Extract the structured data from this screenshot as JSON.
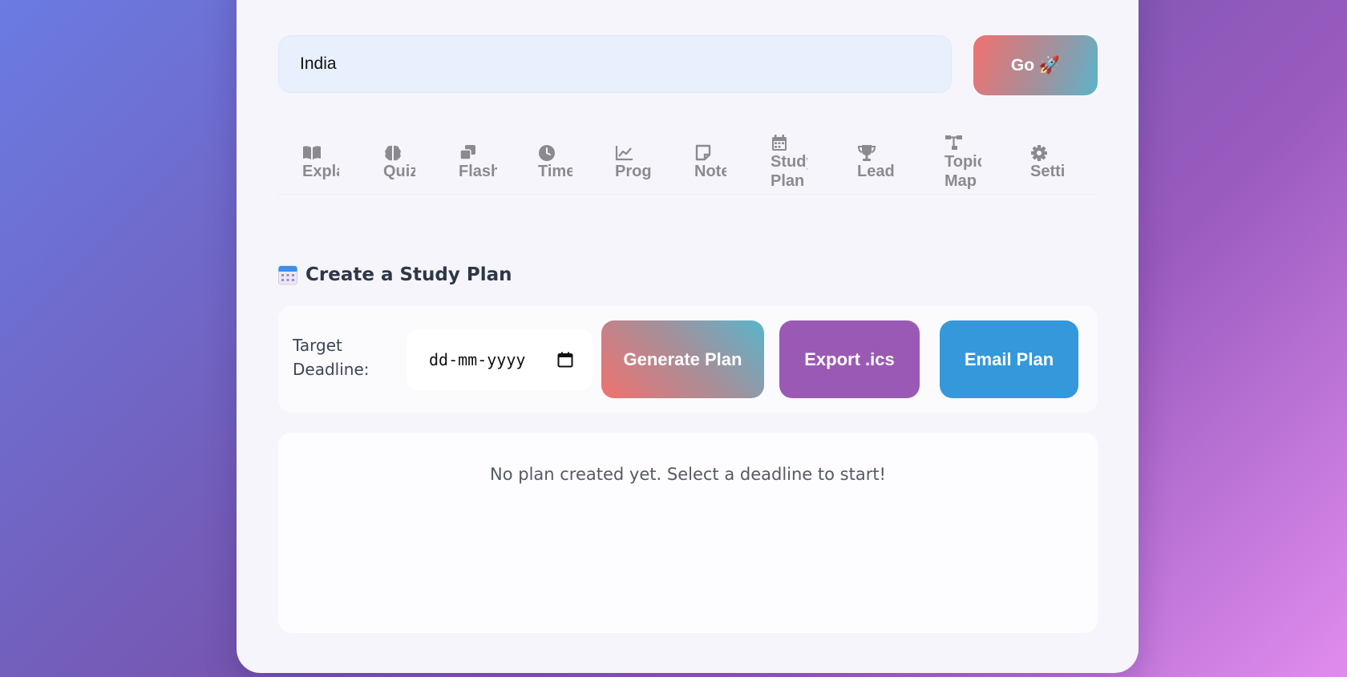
{
  "search": {
    "value": "India",
    "go_label": "Go 🚀"
  },
  "tabs": [
    {
      "label": "Expla",
      "icon": "book-open-icon"
    },
    {
      "label": "Quiz",
      "icon": "brain-icon"
    },
    {
      "label": "Flash",
      "icon": "clone-icon"
    },
    {
      "label": "Time",
      "icon": "clock-icon"
    },
    {
      "label": "Prog",
      "icon": "chart-line-icon"
    },
    {
      "label": "Note",
      "icon": "sticky-note-icon"
    },
    {
      "label": "Study Plan",
      "icon": "calendar-icon"
    },
    {
      "label": "Lead",
      "icon": "trophy-icon"
    },
    {
      "label": "Topic Map",
      "icon": "sitemap-icon"
    },
    {
      "label": "Setti",
      "icon": "gear-icon"
    }
  ],
  "study_plan": {
    "title": "Create a Study Plan",
    "deadline_label": "Target Deadline:",
    "date_placeholder": "dd-mm-yyyy",
    "generate_label": "Generate Plan",
    "export_label": "Export .ics",
    "email_label": "Email Plan",
    "empty_message": "No plan created yet. Select a deadline to start!"
  },
  "colors": {
    "accent_export": "#9b59b6",
    "accent_email": "#3498db",
    "gradient_start": "#f0716f",
    "gradient_end": "#5ab5cb"
  }
}
